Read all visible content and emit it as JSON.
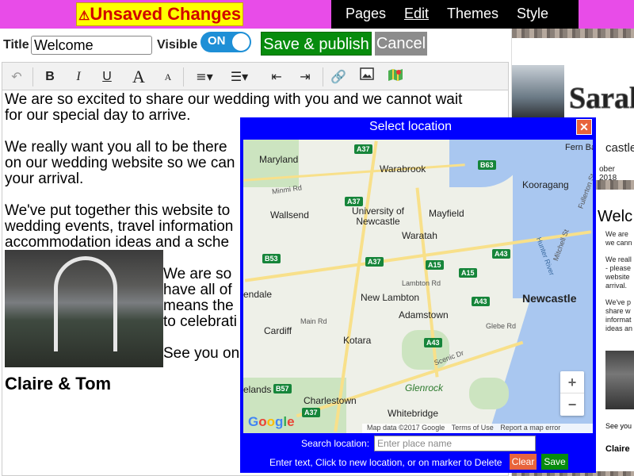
{
  "topbar": {
    "unsaved_icon": "⚠",
    "unsaved_label": "Unsaved Changes",
    "nav": [
      "Pages",
      "Edit",
      "Themes",
      "Style"
    ]
  },
  "editor": {
    "title_label": "Title",
    "title_value": "Welcome",
    "visible_label": "Visible",
    "toggle_label": "ON",
    "save_label": "Save & publish",
    "cancel_label": "Cancel",
    "toolbar": [
      "undo-icon",
      "bold-icon",
      "italic-icon",
      "underline-icon",
      "font-size-larger-icon",
      "font-size-smaller-icon",
      "align-icon",
      "bullet-list-icon",
      "outdent-icon",
      "indent-icon",
      "link-icon",
      "image-icon",
      "map-icon"
    ],
    "paragraphs": [
      "We are so excited to share our wedding with you and we cannot wait",
      "for our special day to arrive.",
      "We really want you all to be there",
      "on our wedding website so we can",
      "your arrival.",
      "We've put together this website to",
      "wedding events, travel information",
      "accommodation ideas and a sche",
      "We are so",
      "have all of",
      "means the",
      "to celebrati",
      "See you on"
    ],
    "signature": "Claire & Tom"
  },
  "preview": {
    "name_partial": "Sarah",
    "location_partial": "castle",
    "date_partial": "ober 2018",
    "heading_partial": "Welc",
    "lines": [
      "We are",
      "we cann",
      "We reall",
      "- please",
      "website",
      "arrival.",
      "We've p",
      "share w",
      "informat",
      "ideas an",
      "See you",
      "Claire"
    ]
  },
  "dialog": {
    "title": "Select location",
    "close_label": "✕",
    "map": {
      "places": [
        "Maryland",
        "Warabrook",
        "Fern Bay",
        "Kooragang",
        "Minmi Rd",
        "University of Newcastle",
        "Wallsend",
        "Mayfield",
        "Waratah",
        "Lambton Rd",
        "New Lambton",
        "Newcastle",
        "endale",
        "Main Rd",
        "Adamstown",
        "Cardiff",
        "Kotara",
        "Glebe Rd",
        "Scenic Dr",
        "Glenrock",
        "elands",
        "Charlestown",
        "Whitebridge",
        "Hunter River",
        "Mitchell St",
        "Fullerton St"
      ],
      "shields": [
        "A37",
        "B63",
        "A37",
        "A43",
        "B53",
        "A37",
        "A15",
        "A15",
        "A43",
        "A43",
        "B57",
        "A37"
      ],
      "attribution": [
        "Map data ©2017 Google",
        "Terms of Use",
        "Report a map error"
      ],
      "google_logo": "Google",
      "zoom_in": "+",
      "zoom_out": "−"
    },
    "search_label": "Search location:",
    "search_placeholder": "Enter place name",
    "hint": "Enter text, Click to new location, or on marker to Delete",
    "clear_label": "Clear",
    "save_label": "Save"
  }
}
